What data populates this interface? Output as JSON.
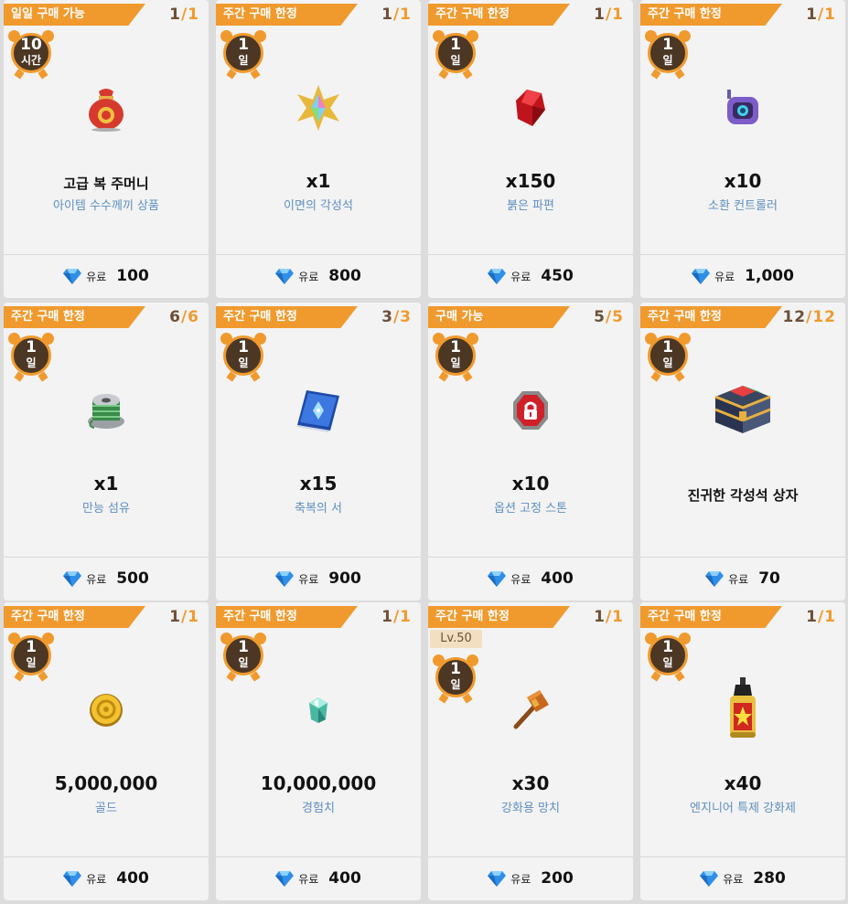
{
  "colors": {
    "tag": "#f09a2e",
    "timer": "#4b3724",
    "name": "#5e8fbf",
    "count": "#6d5038"
  },
  "currency_icon": "blue-diamond-icon",
  "cards": [
    {
      "tag": "일일 구매 가능",
      "count_cur": "1",
      "count_max": "1",
      "timer_num": "10",
      "timer_unit": "시간",
      "icon": "lucky-pouch-icon",
      "qty": "고급 복 주머니",
      "name": "아이템 수수께끼 상품",
      "currency": "유료",
      "price": "100"
    },
    {
      "tag": "주간 구매 한정",
      "count_cur": "1",
      "count_max": "1",
      "timer_num": "1",
      "timer_unit": "일",
      "icon": "rainbow-star-stone-icon",
      "qty": "x1",
      "name": "이면의 각성석",
      "currency": "유료",
      "price": "800"
    },
    {
      "tag": "주간 구매 한정",
      "count_cur": "1",
      "count_max": "1",
      "timer_num": "1",
      "timer_unit": "일",
      "icon": "red-shard-icon",
      "qty": "x150",
      "name": "붉은 파편",
      "currency": "유료",
      "price": "450"
    },
    {
      "tag": "주간 구매 한정",
      "count_cur": "1",
      "count_max": "1",
      "timer_num": "1",
      "timer_unit": "일",
      "icon": "summon-controller-icon",
      "qty": "x10",
      "name": "소환 컨트롤러",
      "currency": "유료",
      "price": "1,000"
    },
    {
      "tag": "주간 구매 한정",
      "count_cur": "6",
      "count_max": "6",
      "timer_num": "1",
      "timer_unit": "일",
      "icon": "thread-spool-icon",
      "qty": "x1",
      "name": "만능 섬유",
      "currency": "유료",
      "price": "500"
    },
    {
      "tag": "주간 구매 한정",
      "count_cur": "3",
      "count_max": "3",
      "timer_num": "1",
      "timer_unit": "일",
      "icon": "blessing-book-icon",
      "qty": "x15",
      "name": "축복의 서",
      "currency": "유료",
      "price": "900"
    },
    {
      "tag": "구매 가능",
      "count_cur": "5",
      "count_max": "5",
      "timer_num": "1",
      "timer_unit": "일",
      "icon": "lock-stone-icon",
      "qty": "x10",
      "name": "옵션 고정 스톤",
      "currency": "유료",
      "price": "400"
    },
    {
      "tag": "주간 구매 한정",
      "count_cur": "12",
      "count_max": "12",
      "timer_num": "1",
      "timer_unit": "일",
      "icon": "treasure-chest-icon",
      "big_name": "진귀한 각성석 상자",
      "currency": "유료",
      "price": "70"
    },
    {
      "tag": "주간 구매 한정",
      "count_cur": "1",
      "count_max": "1",
      "timer_num": "1",
      "timer_unit": "일",
      "icon": "gold-coin-icon",
      "qty": "5,000,000",
      "name": "골드",
      "currency": "유료",
      "price": "400"
    },
    {
      "tag": "주간 구매 한정",
      "count_cur": "1",
      "count_max": "1",
      "timer_num": "1",
      "timer_unit": "일",
      "icon": "exp-crystal-icon",
      "qty": "10,000,000",
      "name": "경험치",
      "currency": "유료",
      "price": "400"
    },
    {
      "tag": "주간 구매 한정",
      "count_cur": "1",
      "count_max": "1",
      "level": "Lv.50",
      "timer_num": "1",
      "timer_unit": "일",
      "icon": "hammer-icon",
      "qty": "x30",
      "name": "강화용 망치",
      "currency": "유료",
      "price": "200"
    },
    {
      "tag": "주간 구매 한정",
      "count_cur": "1",
      "count_max": "1",
      "timer_num": "1",
      "timer_unit": "일",
      "icon": "enhancer-bottle-icon",
      "qty": "x40",
      "name": "엔지니어 특제 강화제",
      "currency": "유료",
      "price": "280"
    }
  ]
}
